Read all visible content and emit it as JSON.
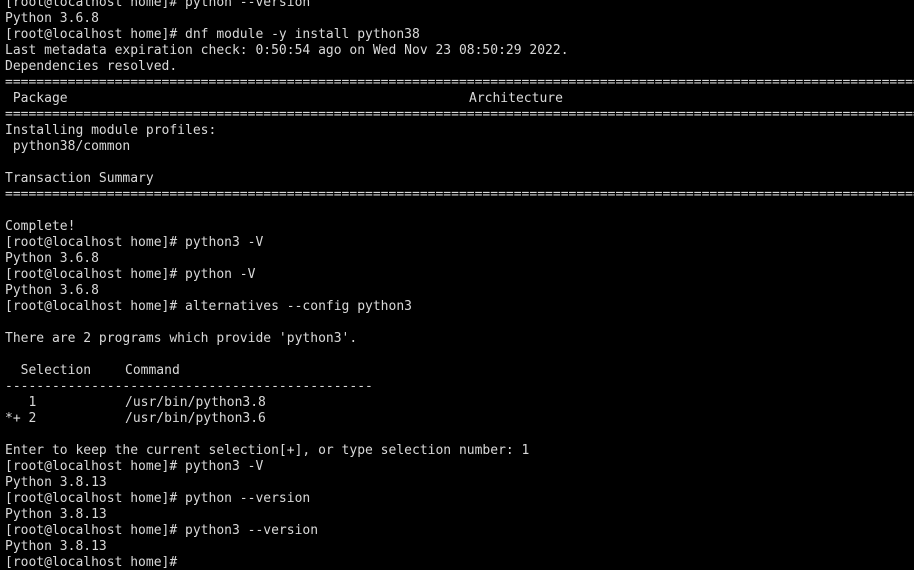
{
  "colors": {
    "background": "#000000",
    "foreground": "#d9d9d9"
  },
  "terminal": {
    "line_00": "[root@localhost home]# python --version",
    "line_01": "Python 3.6.8",
    "line_02": "[root@localhost home]# dnf module -y install python38",
    "line_03": "Last metadata expiration check: 0:50:54 ago on Wed Nov 23 08:50:29 2022.",
    "line_04": "Dependencies resolved.",
    "rule_05": "==========================================================================================================================================",
    "header_package": " Package",
    "header_architecture": "Architecture",
    "rule_07": "==========================================================================================================================================",
    "line_08": "Installing module profiles:",
    "line_09": " python38/common",
    "line_11": "Transaction Summary",
    "rule_12": "==========================================================================================================================================",
    "line_14": "Complete!",
    "line_15": "[root@localhost home]# python3 -V",
    "line_16": "Python 3.6.8",
    "line_17": "[root@localhost home]# python -V",
    "line_18": "Python 3.6.8",
    "line_19": "[root@localhost home]# alternatives --config python3",
    "line_21": "There are 2 programs which provide 'python3'.",
    "header_selection": "  Selection",
    "header_command": "Command",
    "rule_24": "-----------------------------------------------",
    "row1_selection": "   1",
    "row1_command": "/usr/bin/python3.8",
    "row2_selection": "*+ 2",
    "row2_command": "/usr/bin/python3.6",
    "line_28": "Enter to keep the current selection[+], or type selection number: 1",
    "line_29": "[root@localhost home]# python3 -V",
    "line_30": "Python 3.8.13",
    "line_31": "[root@localhost home]# python --version",
    "line_32": "Python 3.8.13",
    "line_33": "[root@localhost home]# python3 --version",
    "line_34": "Python 3.8.13",
    "line_35": "[root@localhost home]# "
  }
}
